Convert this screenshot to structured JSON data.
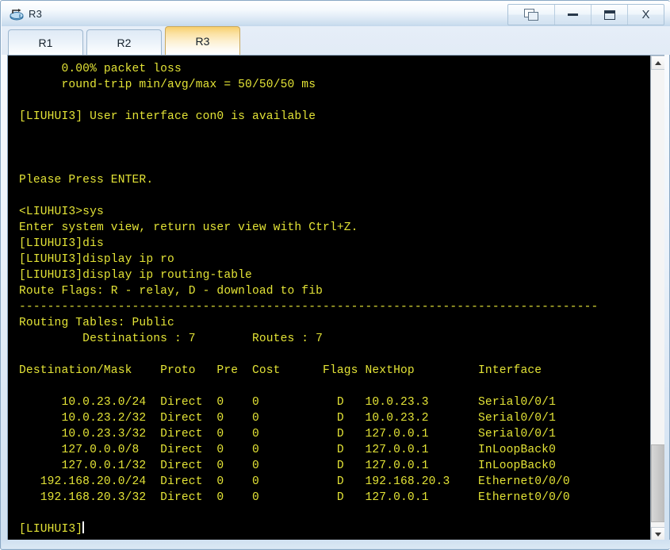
{
  "window": {
    "title": "R3",
    "app_icon": "router-icon",
    "controls": [
      {
        "name": "restore-button",
        "icon": "restore-windows-icon",
        "label": ""
      },
      {
        "name": "minimize-button",
        "icon": "minimize-icon",
        "label": ""
      },
      {
        "name": "maximize-button",
        "icon": "maximize-icon",
        "label": ""
      },
      {
        "name": "close-button",
        "icon": "close-icon",
        "label": "X"
      }
    ]
  },
  "tabs": [
    {
      "label": "R1",
      "active": false
    },
    {
      "label": "R2",
      "active": false
    },
    {
      "label": "R3",
      "active": true
    }
  ],
  "terminal": {
    "foreground": "#e3e336",
    "background": "#000000",
    "lines": [
      "      0.00% packet loss",
      "      round-trip min/avg/max = 50/50/50 ms",
      "",
      "[LIUHUI3] User interface con0 is available",
      "",
      "",
      "",
      "Please Press ENTER.",
      "",
      "<LIUHUI3>sys",
      "Enter system view, return user view with Ctrl+Z.",
      "[LIUHUI3]dis",
      "[LIUHUI3]display ip ro",
      "[LIUHUI3]display ip routing-table",
      "Route Flags: R - relay, D - download to fib",
      "----------------------------------------------------------------------------------",
      "Routing Tables: Public",
      "         Destinations : 7        Routes : 7",
      "",
      "Destination/Mask    Proto   Pre  Cost      Flags NextHop         Interface",
      "",
      "      10.0.23.0/24  Direct  0    0           D   10.0.23.3       Serial0/0/1",
      "      10.0.23.2/32  Direct  0    0           D   10.0.23.2       Serial0/0/1",
      "      10.0.23.3/32  Direct  0    0           D   127.0.0.1       Serial0/0/1",
      "      127.0.0.0/8   Direct  0    0           D   127.0.0.1       InLoopBack0",
      "      127.0.0.1/32  Direct  0    0           D   127.0.0.1       InLoopBack0",
      "   192.168.20.0/24  Direct  0    0           D   192.168.20.3    Ethernet0/0/0",
      "   192.168.20.3/32  Direct  0    0           D   127.0.0.1       Ethernet0/0/0",
      "",
      "[LIUHUI3]"
    ],
    "prompt": "[LIUHUI3]",
    "routing_table": {
      "flags_legend": "Route Flags: R - relay, D - download to fib",
      "table_name": "Routing Tables: Public",
      "destinations": "7",
      "routes": "7",
      "columns": [
        "Destination/Mask",
        "Proto",
        "Pre",
        "Cost",
        "Flags",
        "NextHop",
        "Interface"
      ],
      "rows": [
        [
          "10.0.23.0/24",
          "Direct",
          "0",
          "0",
          "D",
          "10.0.23.3",
          "Serial0/0/1"
        ],
        [
          "10.0.23.2/32",
          "Direct",
          "0",
          "0",
          "D",
          "10.0.23.2",
          "Serial0/0/1"
        ],
        [
          "10.0.23.3/32",
          "Direct",
          "0",
          "0",
          "D",
          "127.0.0.1",
          "Serial0/0/1"
        ],
        [
          "127.0.0.0/8",
          "Direct",
          "0",
          "0",
          "D",
          "127.0.0.1",
          "InLoopBack0"
        ],
        [
          "127.0.0.1/32",
          "Direct",
          "0",
          "0",
          "D",
          "127.0.0.1",
          "InLoopBack0"
        ],
        [
          "192.168.20.0/24",
          "Direct",
          "0",
          "0",
          "D",
          "192.168.20.3",
          "Ethernet0/0/0"
        ],
        [
          "192.168.20.3/32",
          "Direct",
          "0",
          "0",
          "D",
          "127.0.0.1",
          "Ethernet0/0/0"
        ]
      ]
    }
  },
  "scrollbar": {
    "up_arrow": "chevron-up-icon",
    "down_arrow": "chevron-down-icon",
    "thumb_top_pct": 82,
    "thumb_height_pct": 17
  }
}
